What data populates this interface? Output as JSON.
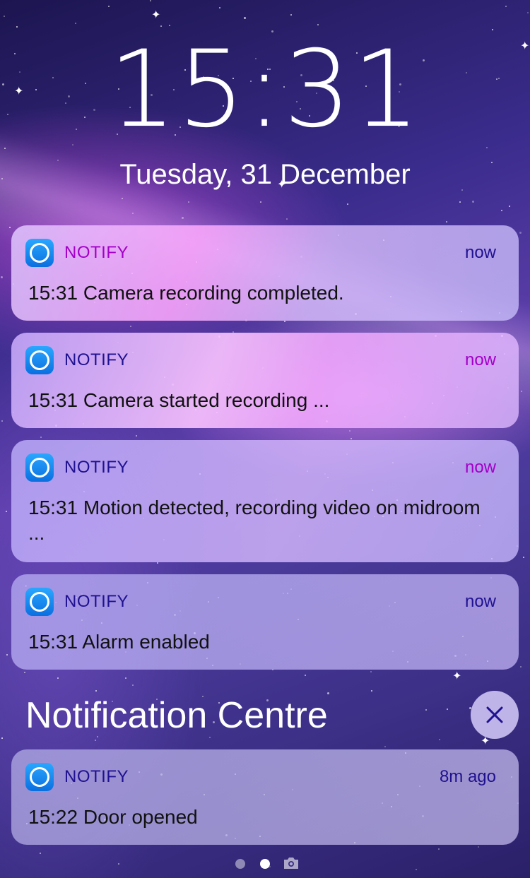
{
  "lock_screen": {
    "time": "15:31",
    "date": "Tuesday, 31 December"
  },
  "notifications": [
    {
      "app": "NOTIFY",
      "time_ago": "now",
      "message": "15:31 Camera recording completed."
    },
    {
      "app": "NOTIFY",
      "time_ago": "now",
      "message": "15:31 Camera started recording ..."
    },
    {
      "app": "NOTIFY",
      "time_ago": "now",
      "message": "15:31 Motion detected, recording video on midroom ..."
    },
    {
      "app": "NOTIFY",
      "time_ago": "now",
      "message": "15:31 Alarm enabled"
    }
  ],
  "notification_centre": {
    "title": "Notification Centre",
    "items": [
      {
        "app": "NOTIFY",
        "time_ago": "8m ago",
        "message": "15:22 Door opened"
      }
    ]
  },
  "icons": {
    "app": "notify-app-icon",
    "close": "close-icon",
    "camera": "camera-icon"
  },
  "colors": {
    "accent_purple": "#a300c8",
    "accent_navy": "#1f1190"
  }
}
